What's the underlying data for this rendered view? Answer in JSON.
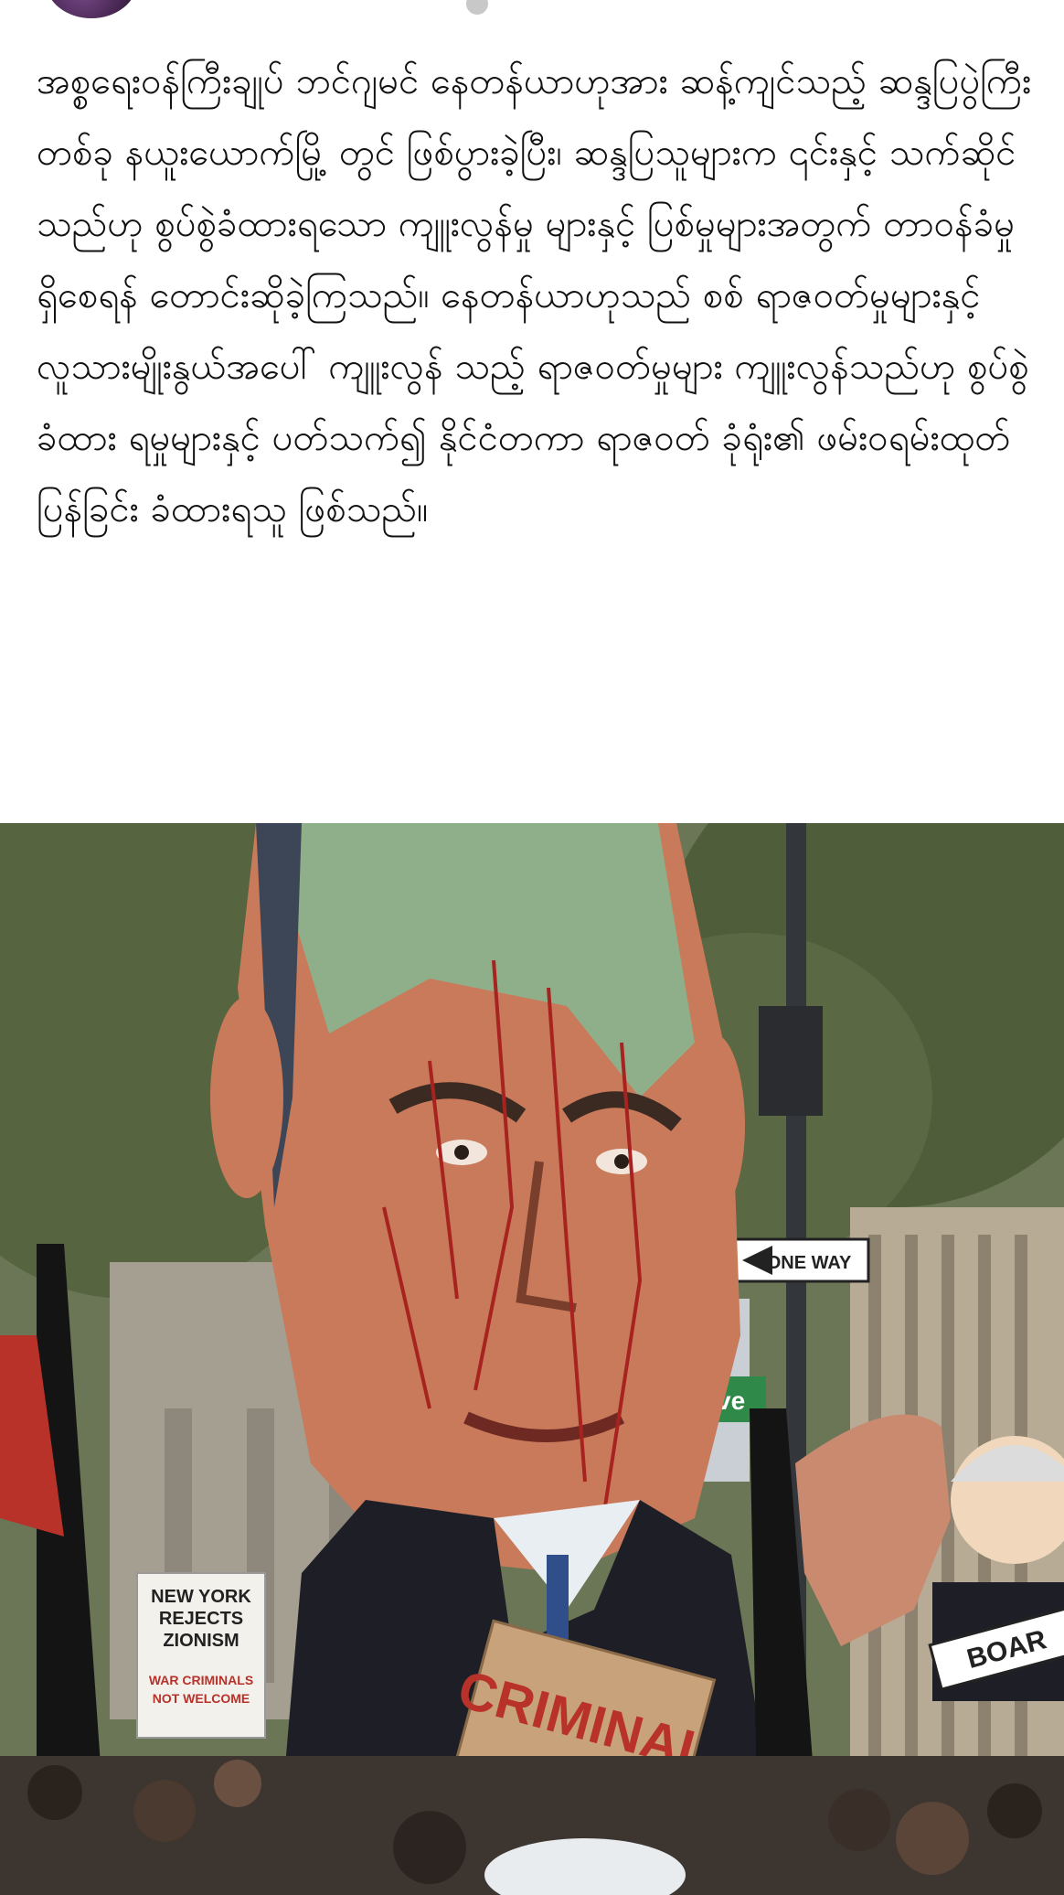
{
  "post": {
    "text": "အစ္စရေးဝန်ကြီးချုပ် ဘင်ဂျမင် နေတန်ယာဟုအား ဆန့်ကျင်သည့် ဆန္ဒပြပွဲကြီးတစ်ခု နယူးယောက်မြို့ တွင် ဖြစ်ပွားခဲ့ပြီး၊ ဆန္ဒပြသူများက ၎င်းနှင့် သက်ဆိုင်သည်ဟု စွပ်စွဲခံထားရသော ကျူးလွန်မှု များနှင့် ပြစ်မှုများအတွက် တာဝန်ခံမှုရှိစေရန် တောင်းဆိုခဲ့ကြသည်။ နေတန်ယာဟုသည် စစ် ရာဇဝတ်မှုများနှင့် လူသားမျိုးနွယ်အပေါ် ကျူးလွန် သည့် ရာဇဝတ်မှုများ ကျူးလွန်သည်ဟု စွပ်စွဲခံထား ရမှုများနှင့် ပတ်သက်၍ နိုင်ငံတကာ ရာဇဝတ် ခုံရုံး၏ ဖမ်းဝရမ်းထုတ်ပြန်ခြင်း ခံထားရသူ ဖြစ်သည်။"
  },
  "photo": {
    "street_sign": "ONE WAY",
    "avenue_sign": "Ave",
    "effigy_sign": "CRIMINAL",
    "protest_sign_line1": "NEW YORK",
    "protest_sign_line2": "REJECTS",
    "protest_sign_line3": "ZIONISM",
    "protest_sign_line4": "WAR CRIMINALS",
    "protest_sign_line5": "NOT WELCOME",
    "right_sign": "BOAR",
    "colors": {
      "effigy_face": "#c97a5a",
      "effigy_green": "#8fae8a",
      "suit": "#1e1f26",
      "cardboard": "#c8a27a",
      "sign_red": "#b8322a",
      "street_green": "#2f8a4a",
      "tree": "#5f6e47"
    }
  }
}
